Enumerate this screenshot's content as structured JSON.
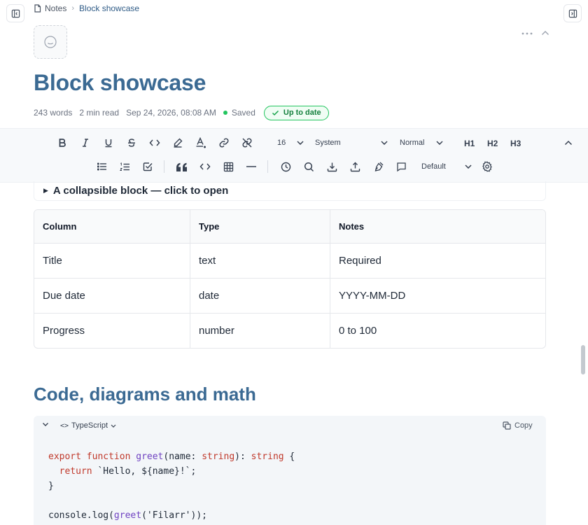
{
  "breadcrumb": {
    "root": "Notes",
    "current": "Block showcase"
  },
  "page": {
    "title": "Block showcase",
    "meta": {
      "words": "243 words",
      "read_time": "2 min read",
      "timestamp": "Sep 24, 2026, 08:08 AM",
      "saved": "Saved",
      "status": "Up to date"
    }
  },
  "toolbar": {
    "font_size": "16",
    "font_family": "System",
    "block_style": "Normal",
    "h1": "H1",
    "h2": "H2",
    "h3": "H3",
    "theme": "Default"
  },
  "collapsible": {
    "label": "A collapsible block — click to open"
  },
  "table": {
    "headers": [
      "Column",
      "Type",
      "Notes"
    ],
    "rows": [
      [
        "Title",
        "text",
        "Required"
      ],
      [
        "Due date",
        "date",
        "YYYY-MM-DD"
      ],
      [
        "Progress",
        "number",
        "0 to 100"
      ]
    ]
  },
  "section": {
    "heading": "Code, diagrams and math"
  },
  "code": {
    "language": "TypeScript",
    "copy_label": "Copy",
    "lines": {
      "l1_kw1": "export",
      "l1_kw2": "function",
      "l1_fn": "greet",
      "l1_a": "(name: ",
      "l1_ty1": "string",
      "l1_b": "): ",
      "l1_ty2": "string",
      "l1_c": " {",
      "l2_kw": "return",
      "l2_rest": " `Hello, ${name}!`;",
      "l3": "}",
      "l5_a": "console.log(",
      "l5_fn": "greet",
      "l5_b": "('Filarr'));"
    }
  },
  "colors": {
    "accent": "#3b6a93",
    "success": "#22c55e",
    "keyword": "#c0392b",
    "function": "#6f42c1"
  }
}
